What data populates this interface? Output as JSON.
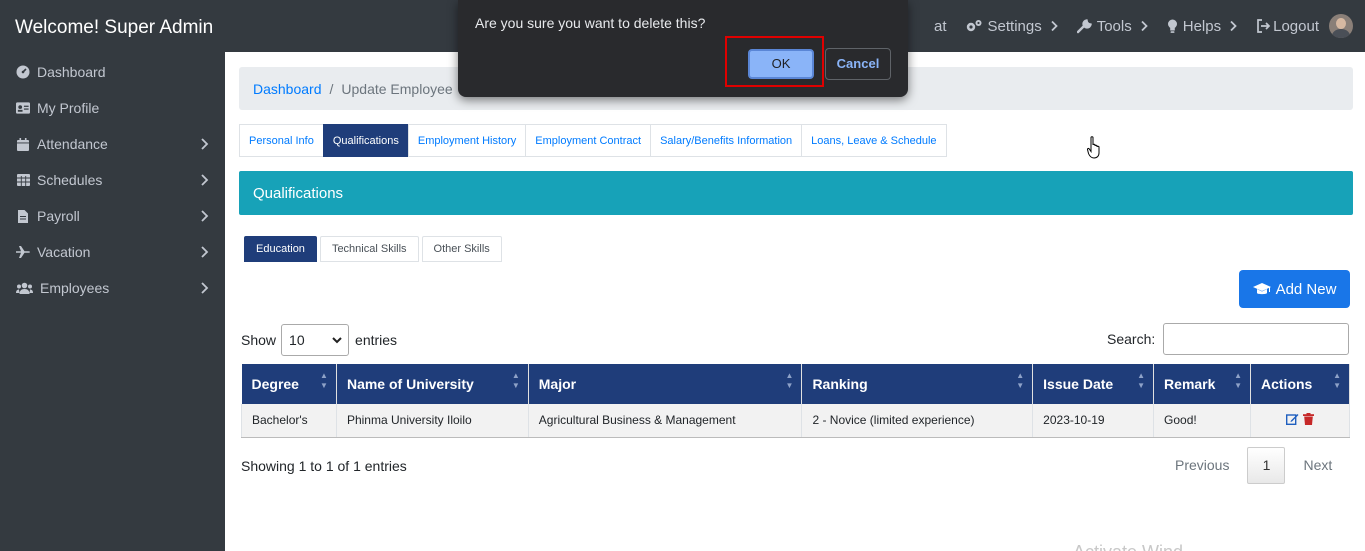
{
  "brand": "Welcome! Super Admin",
  "sidebar": {
    "items": [
      {
        "label": "Dashboard",
        "icon": "dashboard-icon",
        "has_children": false
      },
      {
        "label": "My Profile",
        "icon": "id-card-icon",
        "has_children": false
      },
      {
        "label": "Attendance",
        "icon": "calendar-icon",
        "has_children": true
      },
      {
        "label": "Schedules",
        "icon": "table-icon",
        "has_children": true
      },
      {
        "label": "Payroll",
        "icon": "file-icon",
        "has_children": true
      },
      {
        "label": "Vacation",
        "icon": "plane-icon",
        "has_children": true
      },
      {
        "label": "Employees",
        "icon": "users-icon",
        "has_children": true
      }
    ]
  },
  "topnav": {
    "partial": "at",
    "settings": "Settings",
    "tools": "Tools",
    "helps": "Helps",
    "logout": "Logout"
  },
  "breadcrumb": {
    "root": "Dashboard",
    "separator": "/",
    "current": "Update Employee"
  },
  "tabs": [
    "Personal Info",
    "Qualifications",
    "Employment History",
    "Employment Contract",
    "Salary/Benefits Information",
    "Loans, Leave & Schedule"
  ],
  "active_tab": "Qualifications",
  "card_title": "Qualifications",
  "subtabs": [
    "Education",
    "Technical Skills",
    "Other Skills"
  ],
  "add_button": "Add New",
  "length": {
    "show": "Show",
    "value": "10",
    "entries": "entries"
  },
  "search": {
    "label": "Search:",
    "value": ""
  },
  "table": {
    "columns": [
      "Degree",
      "Name of University",
      "Major",
      "Ranking",
      "Issue Date",
      "Remark",
      "Actions"
    ],
    "rows": [
      [
        "Bachelor's",
        "Phinma University Iloilo",
        "Agricultural Business & Management",
        "2 - Novice (limited experience)",
        "2023-10-19",
        "Good!"
      ]
    ]
  },
  "info": "Showing 1 to 1 of 1 entries",
  "pager": {
    "previous": "Previous",
    "page": "1",
    "next": "Next"
  },
  "watermark": "Activate Wind",
  "dialog": {
    "message": "Are you sure you want to delete this?",
    "ok": "OK",
    "cancel": "Cancel"
  },
  "colors": {
    "sidebar": "#343a40",
    "primary_dark": "#1f3d7a",
    "card_head": "#17a2b8",
    "add_button": "#1976e8",
    "highlight": "#e00000"
  }
}
